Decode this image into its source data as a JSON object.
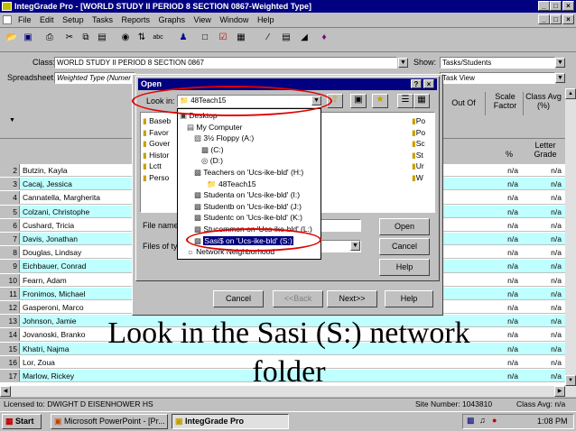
{
  "window": {
    "title": "IntegGrade Pro - [WORLD STUDY II  PERIOD 8 SECTION 0867-Weighted Type]",
    "controls": [
      "_",
      "□",
      "×"
    ],
    "doc_controls": [
      "_",
      "□",
      "×"
    ]
  },
  "menu": [
    "File",
    "Edit",
    "Setup",
    "Tasks",
    "Reports",
    "Graphs",
    "View",
    "Window",
    "Help"
  ],
  "top": {
    "class_label": "Class:",
    "class_value": "WORLD STUDY II  PERIOD 8 SECTION 0867",
    "show_label": "Show:",
    "show_value": "Tasks/Students",
    "spreadsheet_label": "Spreadsheet:",
    "spreadsheet_value": "Weighted Type (Numer",
    "view_value": "Task View"
  },
  "columns": {
    "out_of": "Out Of",
    "scale_factor": "Scale Factor",
    "class_avg": "Class Avg (%)",
    "pct": "%",
    "letter_grade": "Letter Grade"
  },
  "students": [
    {
      "n": "2",
      "name": "Butzin, Kayla",
      "a": "n/a",
      "b": "n/a"
    },
    {
      "n": "3",
      "name": "Cacaj, Jessica",
      "a": "n/a",
      "b": "n/a"
    },
    {
      "n": "4",
      "name": "Cannatella, Margherita",
      "a": "n/a",
      "b": "n/a"
    },
    {
      "n": "5",
      "name": "Colzani, Christophe",
      "a": "n/a",
      "b": "n/a"
    },
    {
      "n": "6",
      "name": "Cushard, Tricia",
      "a": "n/a",
      "b": "n/a"
    },
    {
      "n": "7",
      "name": "Davis, Jonathan",
      "a": "n/a",
      "b": "n/a"
    },
    {
      "n": "8",
      "name": "Douglas, Lindsay",
      "a": "n/a",
      "b": "n/a"
    },
    {
      "n": "9",
      "name": "Eichbauer, Conrad",
      "a": "n/a",
      "b": "n/a"
    },
    {
      "n": "10",
      "name": "Fearn, Adam",
      "a": "n/a",
      "b": "n/a"
    },
    {
      "n": "11",
      "name": "Fronimos, Michael",
      "a": "n/a",
      "b": "n/a"
    },
    {
      "n": "12",
      "name": "Gasperoni, Marco",
      "a": "n/a",
      "b": "n/a"
    },
    {
      "n": "13",
      "name": "Johnson, Jamie",
      "a": "n/a",
      "b": "n/a"
    },
    {
      "n": "14",
      "name": "Jovanoski, Branko",
      "a": "n/a",
      "b": "n/a"
    },
    {
      "n": "15",
      "name": "Khatri, Najma",
      "a": "n/a",
      "b": "n/a"
    },
    {
      "n": "16",
      "name": "Lor, Zoua",
      "a": "n/a",
      "b": "n/a"
    },
    {
      "n": "17",
      "name": "Marlow, Rickey",
      "a": "n/a",
      "b": "n/a"
    }
  ],
  "open_dialog": {
    "title": "Open",
    "look_in_label": "Look in:",
    "look_in_value": "48Teach15",
    "left_folders": [
      "Baseb",
      "Favor",
      "Gover",
      "Histor",
      "Lctt",
      "Perso"
    ],
    "right_folders": [
      "Po",
      "Po",
      "Sc",
      "St",
      "Ur",
      "W"
    ],
    "file_name_label": "File name:",
    "files_of_type_label": "Files of ty",
    "open_button": "Open",
    "cancel_button": "Cancel",
    "help_button": "Help",
    "dropdown": [
      "Desktop",
      "My Computer",
      "3½ Floppy (A:)",
      "(C:)",
      "(D:)",
      "Teachers on 'Ucs-ike-bld' (H:)",
      "48Teach15",
      "Studenta on 'Ucs-ike-bld' (I:)",
      "Studentb on 'Ucs-ike-bld' (J:)",
      "Studentc on 'Ucs-ike-bld' (K:)",
      "Stucommon on 'Ucs-ike-bld' (L:)",
      "Sasi$ on 'Ucs-ike-bld' (S:)",
      "Network Neighborhood"
    ]
  },
  "wizard": {
    "cancel": "Cancel",
    "back": "<<Back",
    "next": "Next>>",
    "help": "Help"
  },
  "caption": {
    "line1": "Look in the Sasi (S:) network",
    "line2": "folder"
  },
  "status": {
    "licensed": "Licensed to: DWIGHT D EISENHOWER HS",
    "site": "Site Number: 1043810",
    "class_avg": "Class Avg: n/a"
  },
  "taskbar": {
    "start": "Start",
    "task1": "Microsoft PowerPoint - [Pr...",
    "task2": "IntegGrade Pro",
    "clock": "1:08 PM"
  },
  "colors": {
    "highlight": "#000080",
    "teal": "#c0ffff",
    "annotation": "#e00000"
  }
}
